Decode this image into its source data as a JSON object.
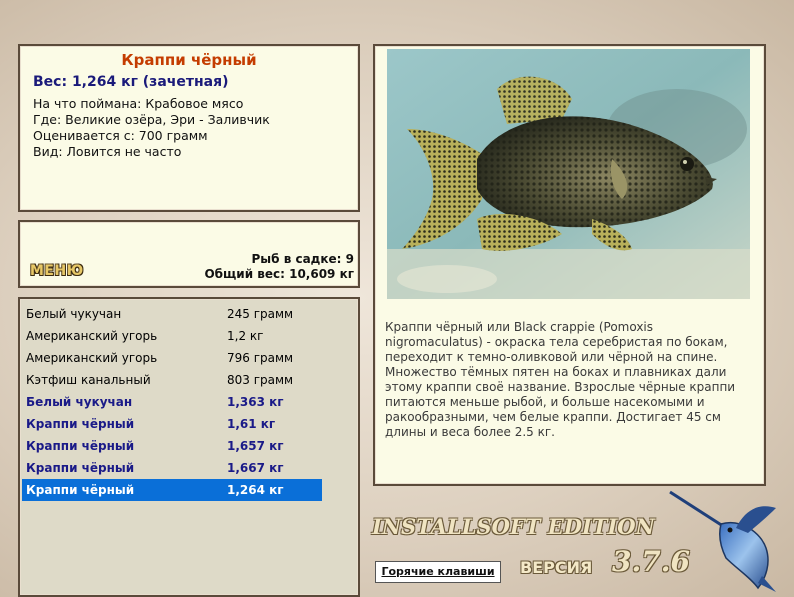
{
  "fish_info": {
    "title": "Краппи чёрный",
    "weight": "Вес: 1,264 кг (зачетная)",
    "bait": "На что поймана: Крабовое мясо",
    "location": "Где: Великие озёра, Эри - Заливчик",
    "valued_from": "Оценивается с: 700 грамм",
    "kind": "Вид: Ловится не часто"
  },
  "menu": {
    "label": "МЕНЮ",
    "fish_in_keepnet": "Рыб в садке: 9",
    "total_weight": "Общий вес: 10,609 кг"
  },
  "catch_list": [
    {
      "name": "Белый чукучан",
      "weight": "245 грамм",
      "style": "normal"
    },
    {
      "name": "Американский угорь",
      "weight": "1,2 кг",
      "style": "normal"
    },
    {
      "name": "Американский угорь",
      "weight": "796 грамм",
      "style": "normal"
    },
    {
      "name": "Кэтфиш канальный",
      "weight": "803 грамм",
      "style": "normal"
    },
    {
      "name": "Белый чукучан",
      "weight": "1,363 кг",
      "style": "bold"
    },
    {
      "name": "Краппи чёрный",
      "weight": "1,61 кг",
      "style": "bold"
    },
    {
      "name": "Краппи чёрный",
      "weight": "1,657 кг",
      "style": "bold"
    },
    {
      "name": "Краппи чёрный",
      "weight": "1,667 кг",
      "style": "bold"
    },
    {
      "name": "Краппи чёрный",
      "weight": "1,264 кг",
      "style": "selected"
    }
  ],
  "description": "Краппи чёрный или Black crappie (Pomoxis nigromaculatus) - окраска тела серебристая по бокам, переходит к темно-оливковой или чёрной на спине. Множество тёмных пятен на боках и плавниках дали этому краппи своё название. Взрослые чёрные краппи питаются меньше рыбой, и больше насекомыми и ракообразными, чем белые краппи. Достигает 45 см длины и веса более 2.5 кг.",
  "footer": {
    "brand": "INSTALLSOFT EDITION",
    "version_label": "ВЕРСИЯ",
    "version": "3.7.6",
    "hotkeys": "Горячие клавиши"
  },
  "icons": {
    "photo": "black-crappie-photo",
    "logo": "marlin-icon"
  }
}
